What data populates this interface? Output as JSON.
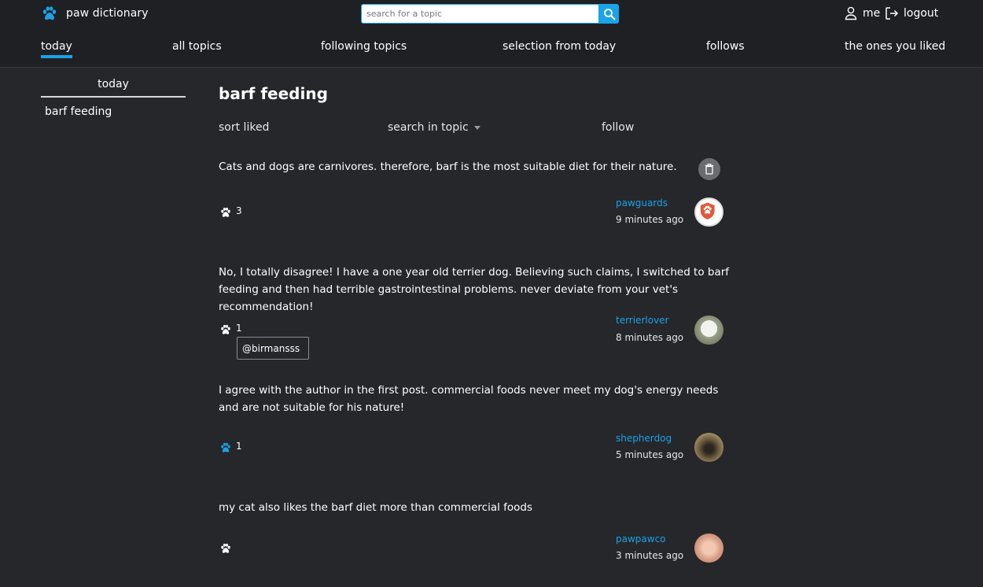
{
  "app": {
    "title": "paw dictionary",
    "accent_color": "#1aa3e6",
    "logo_icon": "paw-icon"
  },
  "search": {
    "placeholder": "search for a topic",
    "value": "",
    "button_icon": "search-icon"
  },
  "user_menu": {
    "me_label": "me",
    "me_icon": "user-icon",
    "logout_label": "logout",
    "logout_icon": "logout-icon"
  },
  "tabs": [
    {
      "label": "today",
      "active": true
    },
    {
      "label": "all topics",
      "active": false
    },
    {
      "label": "following topics",
      "active": false
    },
    {
      "label": "selection from today",
      "active": false
    },
    {
      "label": "follows",
      "active": false
    },
    {
      "label": "the ones you liked",
      "active": false
    }
  ],
  "sidebar": {
    "title": "today",
    "items": [
      {
        "label": "barf feeding"
      }
    ]
  },
  "topic": {
    "title": "barf feeding",
    "sort_label": "sort liked",
    "search_label": "search in topic",
    "follow_label": "follow"
  },
  "entries": [
    {
      "text": "Cats and dogs are carnivores. therefore, barf is the most suitable diet for their nature.",
      "likes": "3",
      "liked": false,
      "author": "pawguards",
      "time": "9 minutes ago",
      "avatar": "pawguards-avatar"
    },
    {
      "text": "No, I totally disagree! I have a one year old terrier dog. Believing such claims, I switched to barf feeding and then had terrible gastrointestinal problems. never deviate from your vet's recommendation!",
      "likes": "1",
      "liked": false,
      "liker_mention": "@birmansss",
      "author": "terrierlover",
      "time": "8 minutes ago",
      "avatar": "terrierlover-avatar"
    },
    {
      "text": "I agree with the author in the first post. commercial foods never meet my dog's energy needs and are not suitable for his nature!",
      "likes": "1",
      "liked": true,
      "author": "shepherdog",
      "time": "5 minutes ago",
      "avatar": "shepherdog-avatar"
    },
    {
      "text": "my cat also likes the barf diet more than commercial foods",
      "likes": "",
      "liked": false,
      "author": "pawpawco",
      "time": "3 minutes ago",
      "avatar": "pawpawco-avatar"
    }
  ],
  "colors": {
    "background": "#26272b",
    "header": "#1f2024",
    "author_link": "#1aa3e6"
  }
}
